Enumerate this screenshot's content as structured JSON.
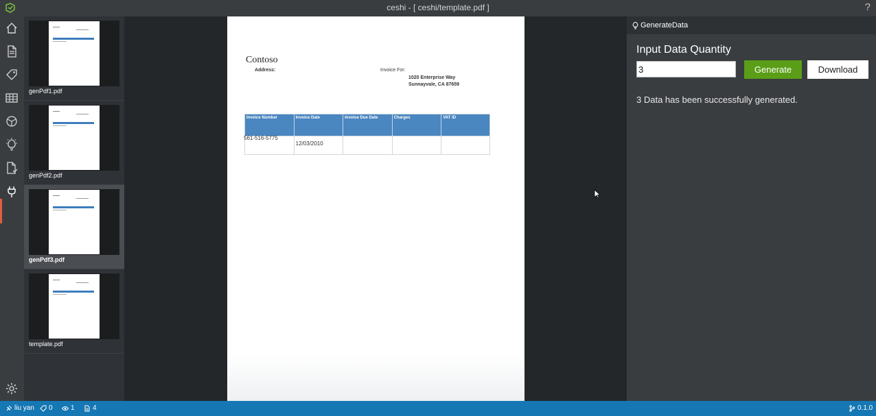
{
  "window": {
    "title": "ceshi - [ ceshi/template.pdf ]",
    "help": "?"
  },
  "sidebar": {
    "icons": [
      "home-icon",
      "document-icon",
      "tag-icon",
      "table-icon",
      "model-icon",
      "bulb-icon",
      "file-check-icon",
      "plug-icon",
      "gear-icon"
    ],
    "active": "plug-icon"
  },
  "thumbnails": [
    {
      "label": "genPdf1.pdf",
      "selected": false
    },
    {
      "label": "genPdf2.pdf",
      "selected": false
    },
    {
      "label": "genPdf3.pdf",
      "selected": true
    },
    {
      "label": "template.pdf",
      "selected": false
    }
  ],
  "document": {
    "company": "Contoso",
    "address_label": "Address:",
    "invoice_for_label": "Invoice For:",
    "address_line1": "1020 Enterprise Way",
    "address_line2": "Sunnayvale, CA 87659",
    "table": {
      "headers": [
        "Invoice Number",
        "Invoice Date",
        "Invoice Due Date",
        "Charges",
        "VAT ID"
      ],
      "row": [
        "561-516-5775",
        "12/03/2010",
        "",
        "",
        ""
      ]
    }
  },
  "panel": {
    "header": "GenerateData",
    "section_title": "Input Data Quantity",
    "quantity_value": "3",
    "generate_label": "Generate",
    "download_label": "Download",
    "status_message": "3 Data has been successfully generated."
  },
  "statusbar": {
    "user": "liu yan",
    "tags_count": "0",
    "visits_count": "1",
    "docs_count": "4",
    "version": "0.1.0"
  },
  "colors": {
    "accent_green": "#5a9e17",
    "statusbar_blue": "#1577b3",
    "table_header_blue": "#4a86c0",
    "active_indicator": "#e05f3e"
  }
}
